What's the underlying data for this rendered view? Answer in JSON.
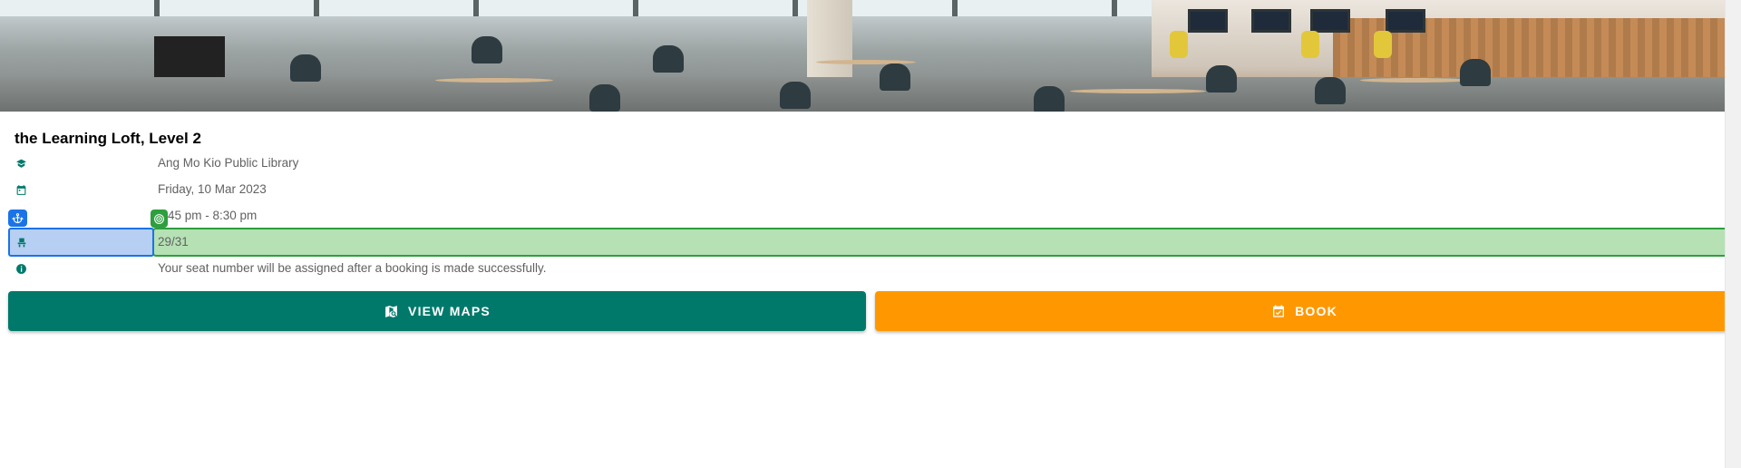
{
  "hero": {
    "image_alt": "the Learning Loft study area"
  },
  "venue": {
    "title": "the Learning Loft, Level 2",
    "rows": [
      {
        "icon": "book-icon",
        "text": "Ang Mo Kio Public Library"
      },
      {
        "icon": "calendar-icon",
        "text": "Friday, 10 Mar 2023"
      },
      {
        "icon": "clock-icon",
        "text": "45 pm - 8:30 pm"
      },
      {
        "icon": "seat-icon",
        "text": "29/31"
      },
      {
        "icon": "info-icon",
        "text": "Your seat number will be assigned after a booking is made successfully."
      }
    ]
  },
  "actions": {
    "view_maps_label": "VIEW MAPS",
    "book_label": "BOOK"
  },
  "colors": {
    "teal": "#00796b",
    "orange": "#ff9800",
    "highlight_blue": "#1a73e8",
    "highlight_green": "#2e9e3e"
  }
}
